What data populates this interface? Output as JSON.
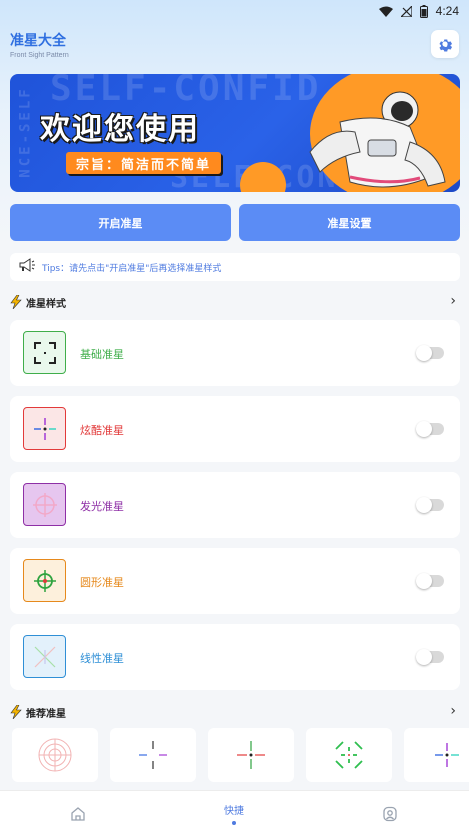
{
  "status_bar": {
    "time": "4:24"
  },
  "header": {
    "title": "准星大全",
    "subtitle": "Front Sight Pattern"
  },
  "banner": {
    "title": "欢迎您使用",
    "slogan": "宗旨：简洁而不简单",
    "bg_text_1": "SELF-CONFID",
    "bg_text_2": "SELF CONFIDEN",
    "bg_text_3": "NCE-SELF"
  },
  "actions": {
    "open_label": "开启准星",
    "settings_label": "准星设置"
  },
  "tips": {
    "text": "Tips：请先点击\"开启准星\"后再选择准星样式"
  },
  "styles_section": {
    "title": "准星样式",
    "items": [
      {
        "label": "基础准星",
        "color": "#3fae4a",
        "icon": "basic-crosshair-icon",
        "enabled": false
      },
      {
        "label": "炫酷准星",
        "color": "#e23a3a",
        "icon": "cool-crosshair-icon",
        "enabled": false
      },
      {
        "label": "发光准星",
        "color": "#8e2fa6",
        "icon": "glow-crosshair-icon",
        "enabled": false
      },
      {
        "label": "圆形准星",
        "color": "#e6891c",
        "icon": "circle-crosshair-icon",
        "enabled": false
      },
      {
        "label": "线性准星",
        "color": "#2f8fd6",
        "icon": "linear-crosshair-icon",
        "enabled": false
      }
    ]
  },
  "recommended_section": {
    "title": "推荐准星"
  },
  "bottom_nav": {
    "center_label": "快捷"
  },
  "colors": {
    "accent": "#5b8cf5",
    "tips_text": "#4f7be0",
    "toggle_off": "#d9d9d9"
  }
}
